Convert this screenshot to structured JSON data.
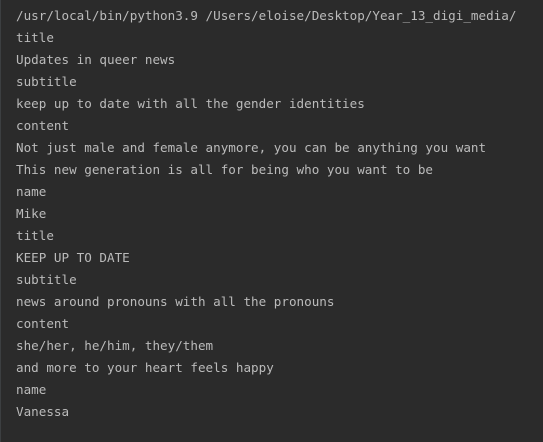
{
  "console": {
    "lines": [
      "/usr/local/bin/python3.9 /Users/eloise/Desktop/Year_13_digi_media/",
      "title",
      "Updates in queer news",
      "subtitle",
      "keep up to date with all the gender identities",
      "content",
      "Not just male and female anymore, you can be anything you want",
      "This new generation is all for being who you want to be",
      "name",
      "Mike",
      "title",
      "KEEP UP TO DATE",
      "subtitle",
      "news around pronouns with all the pronouns",
      "content",
      "she/her, he/him, they/them",
      "and more to your heart feels happy",
      "name",
      "Vanessa"
    ]
  }
}
